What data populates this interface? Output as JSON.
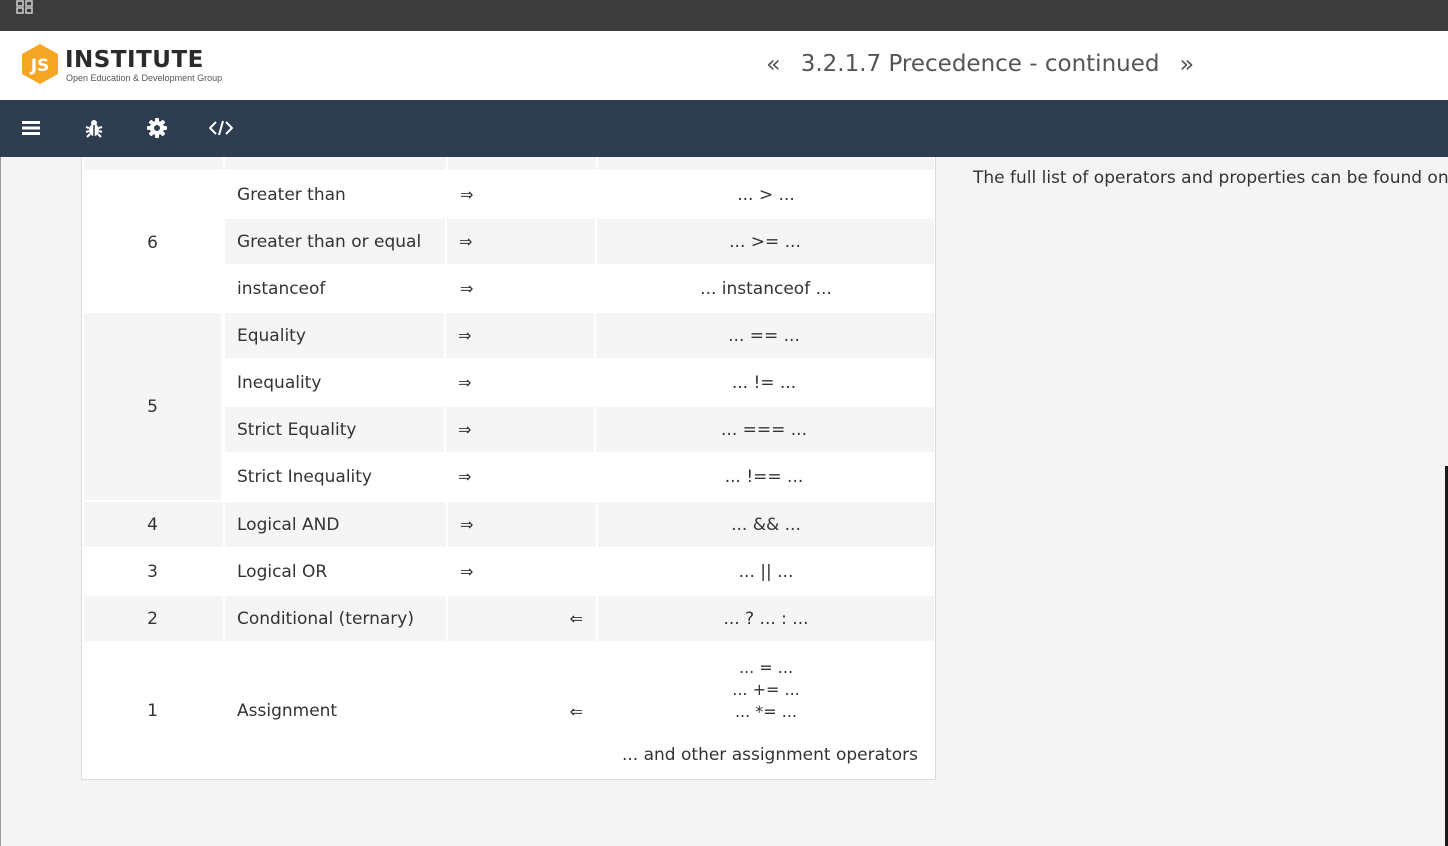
{
  "header": {
    "logo_mark": "JS",
    "logo_name": "INSTITUTE",
    "logo_tagline": "Open Education & Development Group",
    "prev_arrow": "«",
    "title": "3.2.1.7 Precedence - continued",
    "next_arrow": "»"
  },
  "toolbar": {
    "icons": [
      "menu-icon",
      "bug-icon",
      "gear-icon",
      "code-icon"
    ]
  },
  "table": {
    "groups": [
      {
        "precedence": "6",
        "rows": [
          {
            "name": "Greater than",
            "assoc": "⇒",
            "dir": "ltr",
            "syntax": "... > ..."
          },
          {
            "name": "Greater than or equal",
            "assoc": "⇒",
            "dir": "ltr",
            "syntax": "... >= ..."
          },
          {
            "name": "instanceof",
            "assoc": "⇒",
            "dir": "ltr",
            "syntax": "... instanceof ..."
          }
        ]
      },
      {
        "precedence": "5",
        "rows": [
          {
            "name": "Equality",
            "assoc": "⇒",
            "dir": "ltr",
            "syntax": "... == ..."
          },
          {
            "name": "Inequality",
            "assoc": "⇒",
            "dir": "ltr",
            "syntax": "... != ..."
          },
          {
            "name": "Strict Equality",
            "assoc": "⇒",
            "dir": "ltr",
            "syntax": "... === ..."
          },
          {
            "name": "Strict Inequality",
            "assoc": "⇒",
            "dir": "ltr",
            "syntax": "... !== ..."
          }
        ]
      },
      {
        "precedence": "4",
        "rows": [
          {
            "name": "Logical AND",
            "assoc": "⇒",
            "dir": "ltr",
            "syntax": "... && ..."
          }
        ]
      },
      {
        "precedence": "3",
        "rows": [
          {
            "name": "Logical OR",
            "assoc": "⇒",
            "dir": "ltr",
            "syntax": "... || ..."
          }
        ]
      },
      {
        "precedence": "2",
        "rows": [
          {
            "name": "Conditional (ternary)",
            "assoc": "⇐",
            "dir": "rtl",
            "syntax": "... ? ... : ..."
          }
        ]
      }
    ],
    "assignment": {
      "precedence": "1",
      "name": "Assignment",
      "assoc": "⇐",
      "syntax_lines": [
        "... = ...",
        "... += ...",
        "... *= ..."
      ],
      "extra": "... and other assignment operators"
    }
  },
  "side_note": "The full list of operators and properties can be found on th"
}
